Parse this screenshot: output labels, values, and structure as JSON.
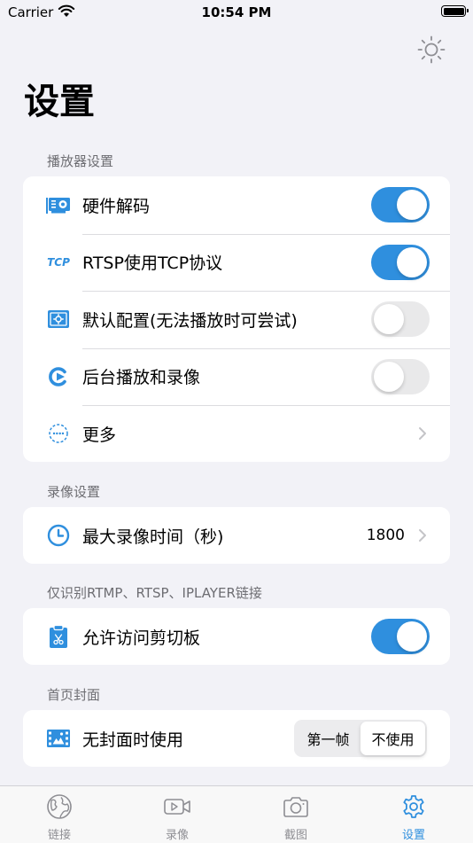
{
  "status_bar": {
    "carrier": "Carrier",
    "time": "10:54 PM"
  },
  "page": {
    "title": "设置"
  },
  "sections": {
    "player": {
      "header": "播放器设置",
      "rows": [
        {
          "label": "硬件解码",
          "icon": "gpu-card-icon",
          "toggle": true
        },
        {
          "label": "RTSP使用TCP协议",
          "icon": "tcp-text-icon",
          "icon_text": "TCP",
          "toggle": true
        },
        {
          "label": "默认配置(无法播放时可尝试)",
          "icon": "default-config-icon",
          "toggle": false
        },
        {
          "label": "后台播放和录像",
          "icon": "background-record-icon",
          "toggle": false
        },
        {
          "label": "更多",
          "icon": "more-dots-icon"
        }
      ]
    },
    "recording": {
      "header": "录像设置",
      "rows": [
        {
          "label": "最大录像时间（秒)",
          "icon": "clock-icon",
          "value": "1800"
        }
      ]
    },
    "links": {
      "header": "仅识别RTMP、RTSP、IPLAYER链接",
      "rows": [
        {
          "label": "允许访问剪切板",
          "icon": "clipboard-icon",
          "toggle": true
        }
      ]
    },
    "cover": {
      "header": "首页封面",
      "rows": [
        {
          "label": "无封面时使用",
          "icon": "image-icon",
          "options": [
            "第一帧",
            "不使用"
          ],
          "selected": "不使用"
        }
      ]
    }
  },
  "tabs": [
    {
      "label": "链接",
      "icon": "globe-icon",
      "active": false
    },
    {
      "label": "录像",
      "icon": "video-icon",
      "active": false
    },
    {
      "label": "截图",
      "icon": "camera-icon",
      "active": false
    },
    {
      "label": "设置",
      "icon": "gear-icon",
      "active": true
    }
  ],
  "colors": {
    "accent": "#2f8fde",
    "background": "#f2f2f7",
    "card": "#ffffff",
    "section_text": "#6d6d72",
    "tab_inactive": "#8e8e93"
  }
}
